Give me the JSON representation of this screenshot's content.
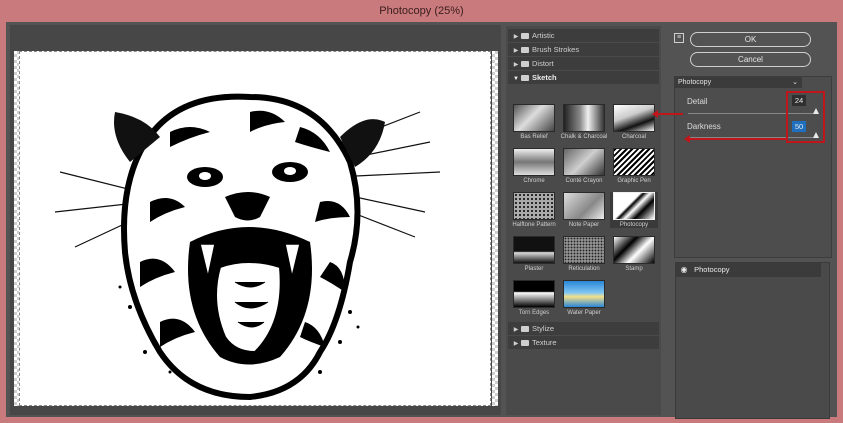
{
  "window": {
    "title": "Photocopy (25%)"
  },
  "gallery": {
    "folders": [
      {
        "label": "Artistic",
        "open": false
      },
      {
        "label": "Brush Strokes",
        "open": false
      },
      {
        "label": "Distort",
        "open": false
      },
      {
        "label": "Sketch",
        "open": true
      },
      {
        "label": "Stylize",
        "open": false
      },
      {
        "label": "Texture",
        "open": false
      }
    ],
    "filters": [
      "Bas Relief",
      "Chalk & Charcoal",
      "Charcoal",
      "Chrome",
      "Conté Crayon",
      "Graphic Pen",
      "Halftone Pattern",
      "Note Paper",
      "Photocopy",
      "Plaster",
      "Reticulation",
      "Stamp",
      "Torn Edges",
      "Water Paper"
    ],
    "selected_filter": "Photocopy"
  },
  "settings": {
    "ok_label": "OK",
    "cancel_label": "Cancel",
    "help_glyph": "≡",
    "filter_select": "Photocopy",
    "detail_label": "Detail",
    "detail_value": "24",
    "darkness_label": "Darkness",
    "darkness_value": "50"
  },
  "layers": {
    "items": [
      {
        "label": "Photocopy",
        "visible": true
      }
    ]
  },
  "colors": {
    "annotation_red": "#c0151b",
    "accent_blue": "#1f6fbf"
  }
}
